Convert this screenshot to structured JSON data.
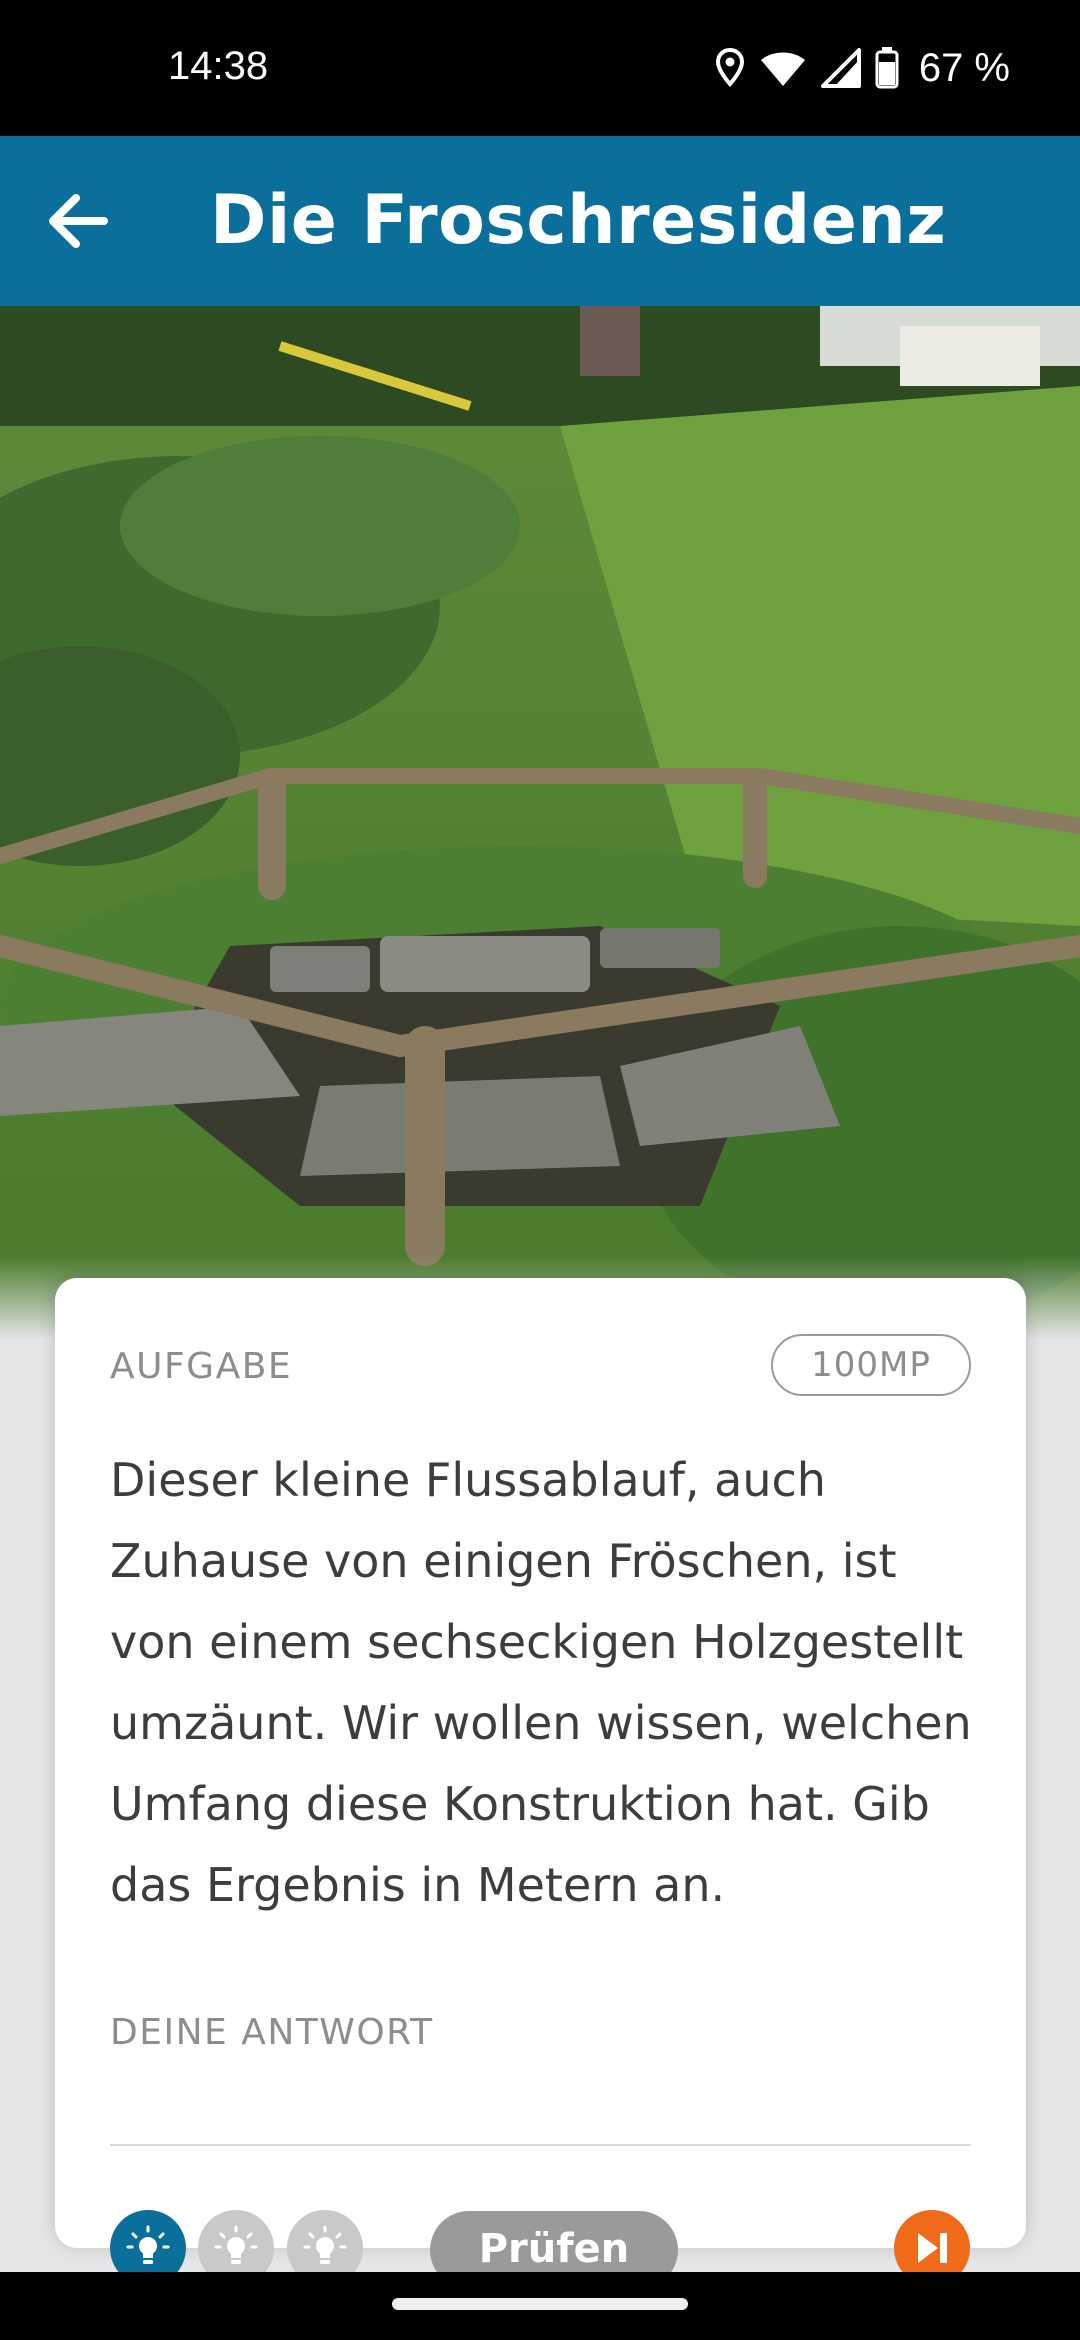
{
  "status_bar": {
    "time": "14:38",
    "battery_percent": "67 %",
    "icons": [
      "location-icon",
      "wifi-icon",
      "signal-icon",
      "battery-icon"
    ]
  },
  "app_bar": {
    "title": "Die Froschresidenz",
    "back_icon": "arrow-left-icon",
    "background_color": "#0b6f9c"
  },
  "task_card": {
    "task_label": "AUFGABE",
    "points": "100MP",
    "task_text": "Dieser kleine Flussablauf, auch Zuhause von einigen Fröschen, ist von einem sechseckigen Holzgestellt umzäunt. Wir wollen wissen, welchen Umfang diese Konstruktion hat. Gib das Ergebnis in Metern an.",
    "answer_label": "DEINE ANTWORT",
    "answer_value": ""
  },
  "action_bar": {
    "hints": [
      {
        "icon": "lightbulb-icon",
        "active": true
      },
      {
        "icon": "lightbulb-icon",
        "active": false
      },
      {
        "icon": "lightbulb-icon",
        "active": false
      }
    ],
    "check_label": "Prüfen",
    "skip_icon": "skip-next-icon",
    "accent_color": "#f06a1a"
  }
}
